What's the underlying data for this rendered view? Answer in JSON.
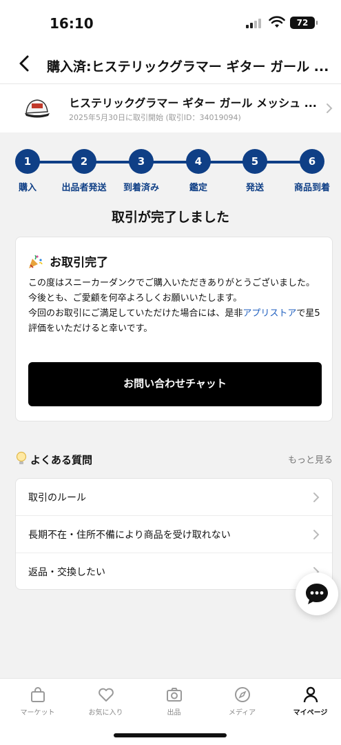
{
  "status_bar": {
    "time": "16:10",
    "battery": "72"
  },
  "header": {
    "title": "購入済:ヒステリックグラマー ギター ガール ..."
  },
  "product": {
    "name": "ヒステリックグラマー ギター ガール メッシュ ...",
    "subtitle": "2025年5月30日に取引開始 (取引ID：34019094)"
  },
  "steps": [
    {
      "num": "1",
      "label": "購入"
    },
    {
      "num": "2",
      "label": "出品者発送"
    },
    {
      "num": "3",
      "label": "到着済み"
    },
    {
      "num": "4",
      "label": "鑑定"
    },
    {
      "num": "5",
      "label": "発送"
    },
    {
      "num": "6",
      "label": "商品到着"
    }
  ],
  "completion": {
    "title": "取引が完了しました",
    "card_title": "お取引完了",
    "line1": "この度はスニーカーダンクでご購入いただきありがとうございました。",
    "line2": "今後とも、ご愛顧を何卒よろしくお願いいたします。",
    "line3_before": "今回のお取引にご満足していただけた場合には、是非",
    "line3_link": "アプリストア",
    "line3_after": "で星5評価をいただけると幸いです。",
    "chat_button": "お問い合わせチャット"
  },
  "faq": {
    "title": "よくある質問",
    "more": "もっと見る",
    "items": [
      {
        "label": "取引のルール"
      },
      {
        "label": "長期不在・住所不備により商品を受け取れない"
      },
      {
        "label": "返品・交換したい"
      }
    ]
  },
  "tabs": [
    {
      "label": "マーケット"
    },
    {
      "label": "お気に入り"
    },
    {
      "label": "出品"
    },
    {
      "label": "メディア"
    },
    {
      "label": "マイページ"
    }
  ],
  "colors": {
    "accent": "#0f3f86",
    "link": "#1f5fbf",
    "button": "#000000"
  }
}
